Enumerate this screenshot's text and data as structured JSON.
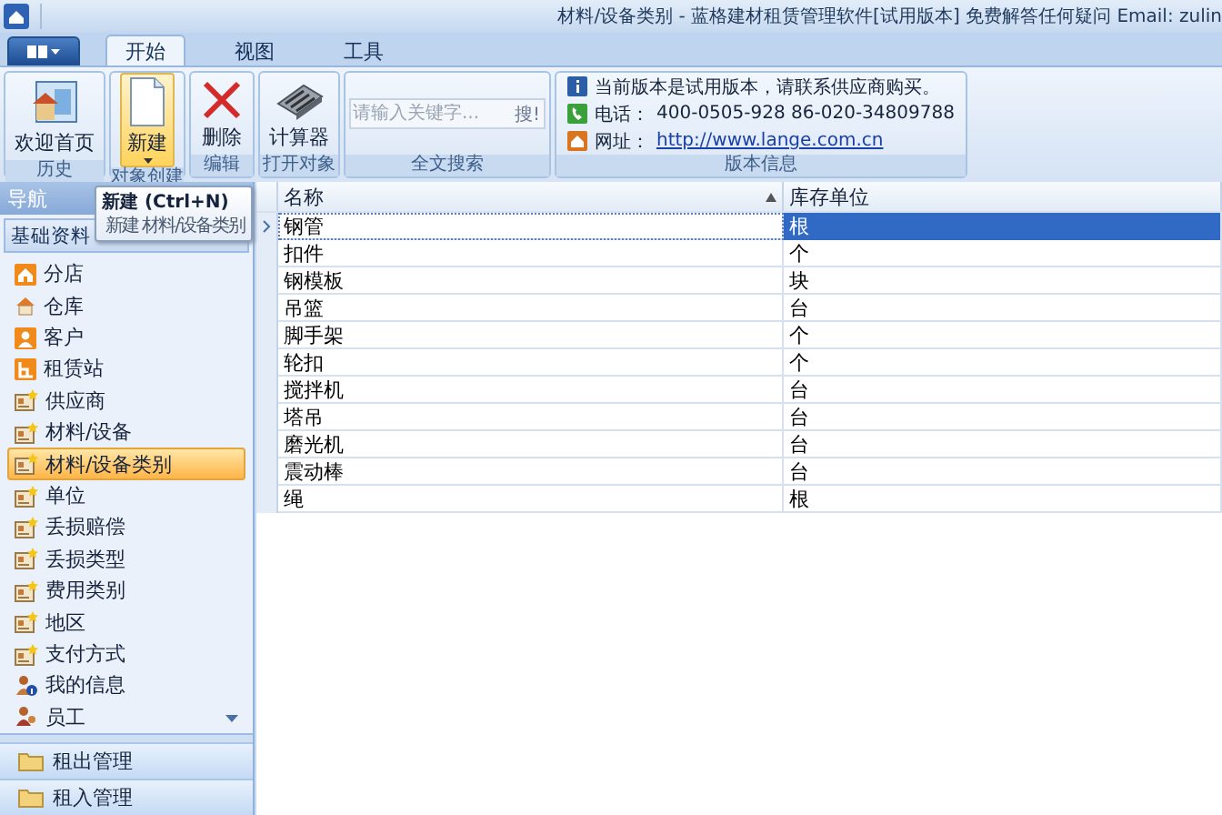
{
  "title_bar": {
    "title": "材料/设备类别 - 蓝格建材租赁管理软件[试用版本] 免费解答任何疑问 Email: zulin"
  },
  "ribbon_tabs": [
    {
      "label": "开始",
      "selected": true
    },
    {
      "label": "视图",
      "selected": false
    },
    {
      "label": "工具",
      "selected": false
    }
  ],
  "ribbon_groups": [
    {
      "label": "历史",
      "items": [
        {
          "kind": "welcome",
          "label": "欢迎首页",
          "pressed": false
        }
      ]
    },
    {
      "label": "对象创建",
      "items": [
        {
          "kind": "new",
          "label": "新建",
          "pressed": true
        }
      ]
    },
    {
      "label": "编辑",
      "items": [
        {
          "kind": "delete",
          "label": "删除",
          "pressed": false
        }
      ]
    },
    {
      "label": "打开对象",
      "items": [
        {
          "kind": "calculator",
          "label": "计算器",
          "pressed": false
        }
      ]
    },
    {
      "label": "全文搜索",
      "search": {
        "placeholder": "请输入关键字...",
        "button": "搜!"
      }
    },
    {
      "label": "版本信息",
      "info": [
        {
          "kind": "notice",
          "text": "当前版本是试用版本，请联系供应商购买。"
        },
        {
          "kind": "phone",
          "label": "电话：",
          "text": "400-0505-928  86-020-34809788"
        },
        {
          "kind": "web",
          "label": "网址：",
          "link": "http://www.lange.com.cn"
        }
      ]
    }
  ],
  "tooltip": {
    "title": "新建 (Ctrl+N)",
    "description": "新建 材料/设备类别"
  },
  "sidebar": {
    "title": "导航",
    "group": "基础资料",
    "items": [
      {
        "kind": "home",
        "label": "分店",
        "selected": false
      },
      {
        "kind": "house",
        "label": "仓库",
        "selected": false
      },
      {
        "kind": "person",
        "label": "客户",
        "selected": false
      },
      {
        "kind": "station",
        "label": "租赁站",
        "selected": false
      },
      {
        "kind": "record",
        "label": "供应商",
        "selected": false
      },
      {
        "kind": "record",
        "label": "材料/设备",
        "selected": false
      },
      {
        "kind": "record",
        "label": "材料/设备类别",
        "selected": true
      },
      {
        "kind": "record",
        "label": "单位",
        "selected": false
      },
      {
        "kind": "record",
        "label": "丢损赔偿",
        "selected": false
      },
      {
        "kind": "record",
        "label": "丢损类型",
        "selected": false
      },
      {
        "kind": "record",
        "label": "费用类别",
        "selected": false
      },
      {
        "kind": "record",
        "label": "地区",
        "selected": false
      },
      {
        "kind": "record",
        "label": "支付方式",
        "selected": false
      },
      {
        "kind": "userinfo",
        "label": "我的信息",
        "selected": false
      },
      {
        "kind": "staff",
        "label": "员工",
        "selected": false
      }
    ],
    "sections": [
      {
        "label": "租出管理"
      },
      {
        "label": "租入管理"
      }
    ]
  },
  "grid": {
    "columns": [
      {
        "label": "名称",
        "sorted": true
      },
      {
        "label": "库存单位",
        "sorted": false
      }
    ],
    "rows": [
      {
        "cells": [
          "钢管",
          "根"
        ],
        "selected": true
      },
      {
        "cells": [
          "扣件",
          "个"
        ],
        "selected": false
      },
      {
        "cells": [
          "钢模板",
          "块"
        ],
        "selected": false
      },
      {
        "cells": [
          "吊篮",
          "台"
        ],
        "selected": false
      },
      {
        "cells": [
          "脚手架",
          "个"
        ],
        "selected": false
      },
      {
        "cells": [
          "轮扣",
          "个"
        ],
        "selected": false
      },
      {
        "cells": [
          "搅拌机",
          "台"
        ],
        "selected": false
      },
      {
        "cells": [
          "塔吊",
          "台"
        ],
        "selected": false
      },
      {
        "cells": [
          "磨光机",
          "台"
        ],
        "selected": false
      },
      {
        "cells": [
          "震动棒",
          "台"
        ],
        "selected": false
      },
      {
        "cells": [
          "绳",
          "根"
        ],
        "selected": false
      }
    ]
  }
}
